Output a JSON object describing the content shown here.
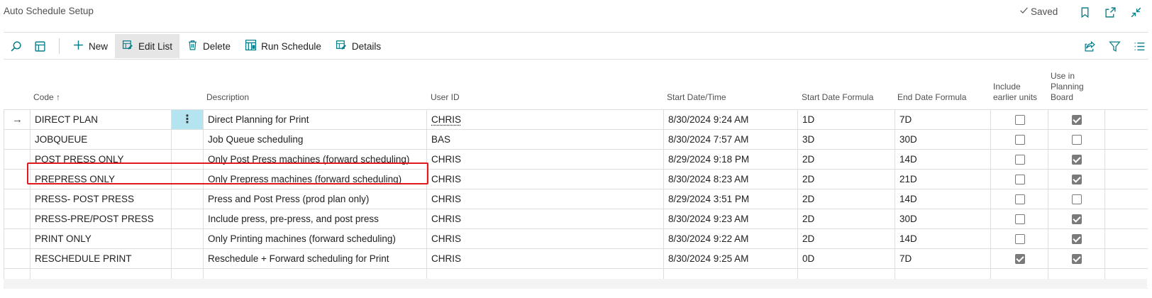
{
  "header": {
    "title": "Auto Schedule Setup",
    "status": "Saved"
  },
  "toolbar": {
    "new_label": "New",
    "edit_list_label": "Edit List",
    "delete_label": "Delete",
    "run_schedule_label": "Run Schedule",
    "details_label": "Details"
  },
  "columns": {
    "code": "Code ↑",
    "description": "Description",
    "user_id": "User ID",
    "start_datetime": "Start Date/Time",
    "start_formula": "Start Date Formula",
    "end_formula": "End Date Formula",
    "include_earlier_1": "Include",
    "include_earlier_2": "earlier units",
    "use_planning_1": "Use in",
    "use_planning_2": "Planning",
    "use_planning_3": "Board"
  },
  "rows": [
    {
      "code": "DIRECT PLAN",
      "description": "Direct Planning for Print",
      "user_id": "CHRIS",
      "start_datetime": "8/30/2024 9:24 AM",
      "start_formula": "1D",
      "end_formula": "7D",
      "include_earlier": false,
      "use_planning": true
    },
    {
      "code": "JOBQUEUE",
      "description": "Job Queue scheduling",
      "user_id": "BAS",
      "start_datetime": "8/30/2024 7:57 AM",
      "start_formula": "3D",
      "end_formula": "30D",
      "include_earlier": false,
      "use_planning": false
    },
    {
      "code": "POST PRESS ONLY",
      "description": "Only Post Press machines (forward scheduling)",
      "user_id": "CHRIS",
      "start_datetime": "8/29/2024 9:18 PM",
      "start_formula": "2D",
      "end_formula": "14D",
      "include_earlier": false,
      "use_planning": true
    },
    {
      "code": "PREPRESS ONLY",
      "description": "Only Prepress machines (forward scheduling)",
      "user_id": "CHRIS",
      "start_datetime": "8/30/2024 8:23 AM",
      "start_formula": "2D",
      "end_formula": "21D",
      "include_earlier": false,
      "use_planning": true
    },
    {
      "code": "PRESS- POST PRESS",
      "description": "Press and Post Press (prod plan only)",
      "user_id": "CHRIS",
      "start_datetime": "8/29/2024 3:51 PM",
      "start_formula": "2D",
      "end_formula": "14D",
      "include_earlier": false,
      "use_planning": false
    },
    {
      "code": "PRESS-PRE/POST PRESS",
      "description": "Include press, pre-press, and post press",
      "user_id": "CHRIS",
      "start_datetime": "8/30/2024 9:23 AM",
      "start_formula": "2D",
      "end_formula": "30D",
      "include_earlier": false,
      "use_planning": true
    },
    {
      "code": "PRINT ONLY",
      "description": "Only Printing machines (forward scheduling)",
      "user_id": "CHRIS",
      "start_datetime": "8/30/2024 9:22 AM",
      "start_formula": "2D",
      "end_formula": "14D",
      "include_earlier": false,
      "use_planning": true
    },
    {
      "code": "RESCHEDULE PRINT",
      "description": "Reschedule + Forward scheduling for Print",
      "user_id": "CHRIS",
      "start_datetime": "8/30/2024 9:25 AM",
      "start_formula": "0D",
      "end_formula": "7D",
      "include_earlier": true,
      "use_planning": true
    }
  ],
  "colors": {
    "accent": "#0a7f8c",
    "row_menu_bg": "#b3e4ef",
    "highlight_box": "#e0191f"
  },
  "icons": [
    "search-icon",
    "layout-icon",
    "plus-icon",
    "edit-list-icon",
    "trash-icon",
    "run-schedule-icon",
    "details-icon",
    "share-icon",
    "filter-icon",
    "list-icon",
    "bookmark-icon",
    "open-new-icon",
    "collapse-icon",
    "checkmark-icon",
    "arrow-right-icon"
  ]
}
